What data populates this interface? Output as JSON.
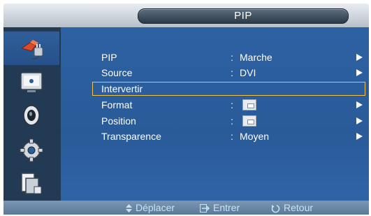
{
  "header": {
    "title": "PIP"
  },
  "sidebar": {
    "items": [
      {
        "icon": "input-plug-icon",
        "active": true
      },
      {
        "icon": "picture-icon"
      },
      {
        "icon": "sound-icon"
      },
      {
        "icon": "setup-gear-icon"
      },
      {
        "icon": "multi-screen-icon"
      }
    ]
  },
  "menu": {
    "items": [
      {
        "label": "PIP",
        "value": "Marche",
        "has_arrow": true
      },
      {
        "label": "Source",
        "value": "DVI",
        "has_arrow": true
      },
      {
        "label": "Intervertir",
        "value": "",
        "has_arrow": false,
        "selected": true
      },
      {
        "label": "Format",
        "value": "",
        "has_arrow": true,
        "value_icon": "pip-size-icon"
      },
      {
        "label": "Position",
        "value": "",
        "has_arrow": true,
        "value_icon": "pip-position-icon"
      },
      {
        "label": "Transparence",
        "value": "Moyen",
        "has_arrow": true
      }
    ],
    "colon": ":"
  },
  "footer": {
    "move_label": "Déplacer",
    "enter_label": "Entrer",
    "return_label": "Retour"
  },
  "colors": {
    "selection": "#f0c44a",
    "panel": "#2c61a2",
    "sidebar": "#233a54"
  }
}
